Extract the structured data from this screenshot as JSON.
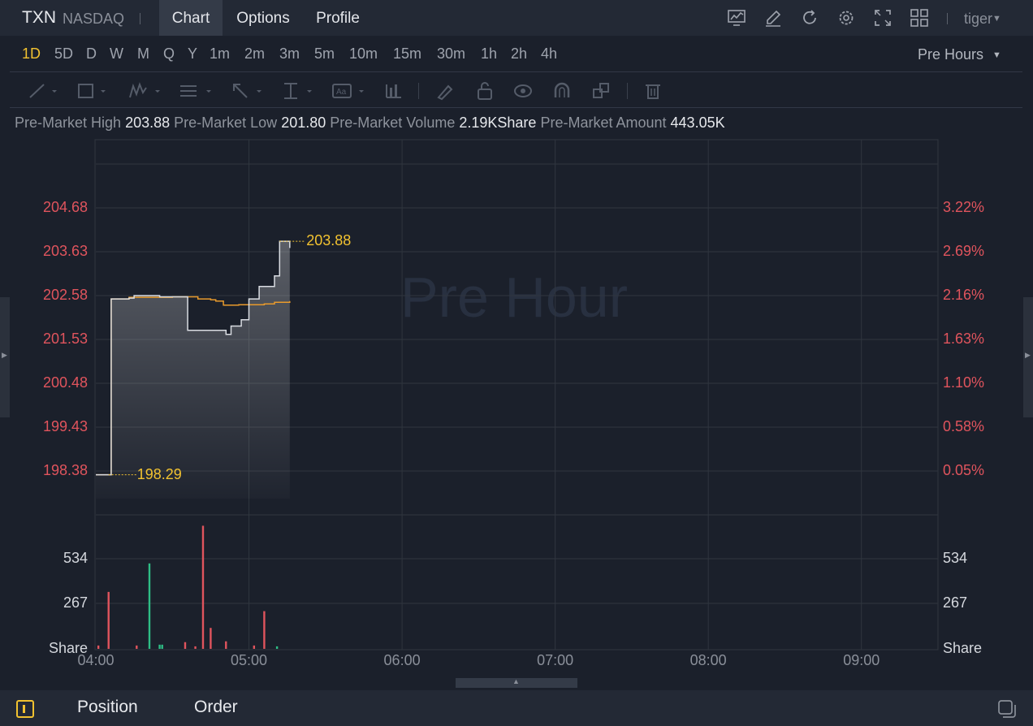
{
  "header": {
    "symbol": "TXN",
    "exchange": "NASDAQ",
    "tabs": [
      "Chart",
      "Options",
      "Profile"
    ],
    "active_tab": "Chart",
    "user": "tiger",
    "toolbar_icons": [
      "indicator-chart-icon",
      "draw-pen-icon",
      "refresh-icon",
      "settings-gear-icon",
      "fullscreen-icon",
      "layout-grid-icon"
    ]
  },
  "periods": {
    "items": [
      "1D",
      "5D",
      "D",
      "W",
      "M",
      "Q",
      "Y",
      "1m",
      "2m",
      "3m",
      "5m",
      "10m",
      "15m",
      "30m",
      "1h",
      "2h",
      "4h"
    ],
    "active": "1D",
    "session": "Pre Hours"
  },
  "stats": {
    "high_label": "Pre-Market High",
    "high_value": "203.88",
    "low_label": "Pre-Market Low",
    "low_value": "201.80",
    "volume_label": "Pre-Market Volume",
    "volume_value": "2.19KShare",
    "amount_label": "Pre-Market Amount",
    "amount_value": "443.05K"
  },
  "watermark": "Pre Hour",
  "chart_data": {
    "type": "line",
    "price_axis_left": [
      "204.68",
      "203.63",
      "202.58",
      "201.53",
      "200.48",
      "199.43",
      "198.38"
    ],
    "percent_axis_right": [
      "3.22%",
      "2.69%",
      "2.16%",
      "1.63%",
      "1.10%",
      "0.58%",
      "0.05%"
    ],
    "ylim": [
      198.38,
      204.68
    ],
    "x_tick_labels": [
      "04:00",
      "05:00",
      "06:00",
      "07:00",
      "08:00",
      "09:00"
    ],
    "xlim": [
      "04:00",
      "09:30"
    ],
    "high_marker": "203.88",
    "low_marker": "198.29",
    "series": [
      {
        "name": "price",
        "color": "#d9dce2",
        "x": [
          "04:00",
          "04:05",
          "04:06",
          "04:13",
          "04:15",
          "04:25",
          "04:30",
          "04:36",
          "04:48",
          "04:51",
          "04:53",
          "04:57",
          "05:00",
          "05:04",
          "05:07",
          "05:10",
          "05:12",
          "05:16"
        ],
        "y": [
          198.29,
          198.29,
          202.5,
          202.52,
          202.58,
          202.55,
          202.55,
          201.75,
          201.75,
          201.65,
          201.85,
          202.0,
          202.5,
          202.8,
          202.8,
          203.05,
          203.88,
          203.72
        ]
      },
      {
        "name": "average",
        "color": "#e89a2c",
        "x": [
          "04:00",
          "04:05",
          "04:06",
          "04:13",
          "04:30",
          "04:40",
          "04:45",
          "04:47",
          "04:50",
          "04:56",
          "05:06",
          "05:10",
          "05:16"
        ],
        "y": [
          198.29,
          198.29,
          202.5,
          202.54,
          202.55,
          202.5,
          202.48,
          202.45,
          202.35,
          202.36,
          202.38,
          202.42,
          202.45
        ]
      }
    ],
    "volume": {
      "axis_labels": [
        "534",
        "267",
        "Share"
      ],
      "ylim": [
        0,
        800
      ],
      "bars": [
        {
          "t": "04:01",
          "v": 20,
          "c": "red"
        },
        {
          "t": "04:05",
          "v": 340,
          "c": "red"
        },
        {
          "t": "04:16",
          "v": 20,
          "c": "red"
        },
        {
          "t": "04:21",
          "v": 510,
          "c": "green"
        },
        {
          "t": "04:25",
          "v": 25,
          "c": "green"
        },
        {
          "t": "04:26",
          "v": 25,
          "c": "green"
        },
        {
          "t": "04:35",
          "v": 40,
          "c": "red"
        },
        {
          "t": "04:39",
          "v": 15,
          "c": "red"
        },
        {
          "t": "04:42",
          "v": 735,
          "c": "red"
        },
        {
          "t": "04:45",
          "v": 125,
          "c": "red"
        },
        {
          "t": "04:51",
          "v": 45,
          "c": "red"
        },
        {
          "t": "05:02",
          "v": 20,
          "c": "red"
        },
        {
          "t": "05:06",
          "v": 225,
          "c": "red"
        },
        {
          "t": "05:11",
          "v": 15,
          "c": "green"
        }
      ]
    }
  },
  "bottom": {
    "tabs": [
      "Position",
      "Order"
    ],
    "icons": [
      "panel-toggle-icon",
      "window-copy-icon"
    ]
  }
}
